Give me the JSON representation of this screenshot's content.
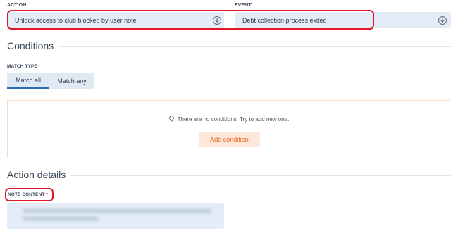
{
  "fields": {
    "action_label": "ACTION",
    "action_value": "Unlock access to club blocked by user note",
    "event_label": "EVENT",
    "event_value": "Debt collection process exited"
  },
  "conditions": {
    "title": "Conditions",
    "match_type_label": "MATCH TYPE",
    "match_all": "Match all",
    "match_any": "Match any",
    "selected": "Match all",
    "empty_message": "There are no conditions. Try to add new one.",
    "add_button": "Add condition"
  },
  "action_details": {
    "title": "Action details",
    "note_content_label": "NOTE CONTENT",
    "required_marker": "*"
  },
  "icons": {
    "dropdown": "arrow-down-circle-icon",
    "hint": "lightbulb-icon"
  },
  "colors": {
    "accent": "#2b6cb0",
    "highlight": "#e2182a",
    "add_button_text": "#ea6a2c",
    "add_button_bg": "#fde7da",
    "field_bg": "#e4edf7"
  }
}
